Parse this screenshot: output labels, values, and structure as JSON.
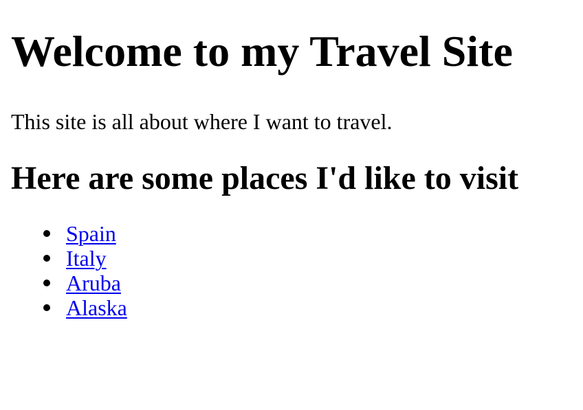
{
  "page": {
    "heading": "Welcome to my Travel Site",
    "intro": "This site is all about where I want to travel.",
    "subheading": "Here are some places I'd like to visit",
    "places": [
      {
        "label": "Spain"
      },
      {
        "label": "Italy"
      },
      {
        "label": "Aruba"
      },
      {
        "label": "Alaska"
      }
    ]
  },
  "colors": {
    "link": "#0000ee",
    "text": "#000000",
    "background": "#ffffff"
  }
}
